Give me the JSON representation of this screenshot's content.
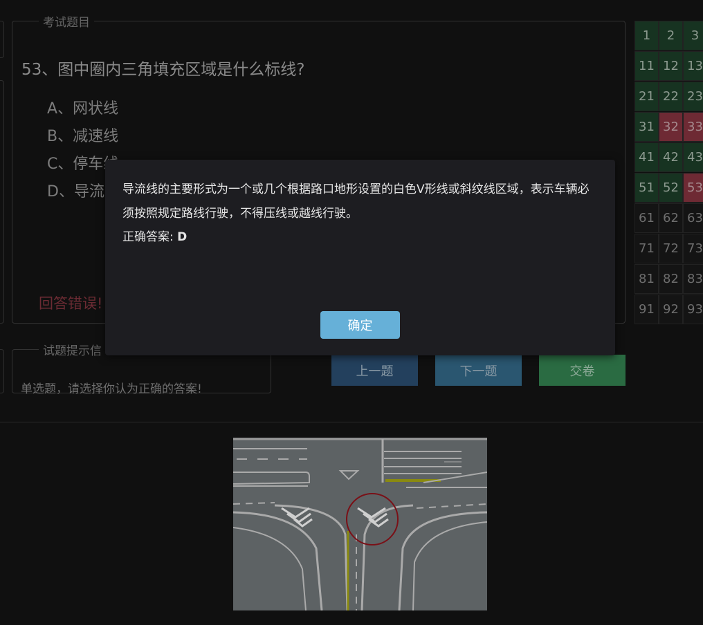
{
  "question_panel": {
    "legend": "考试题目",
    "question": "53、图中圈内三角填充区域是什么标线?",
    "options": [
      "A、网状线",
      "B、减速线",
      "C、停车线",
      "D、导流"
    ],
    "result": "回答错误!"
  },
  "hint_panel": {
    "legend": "试题提示信",
    "text": "单选题，请选择你认为正确的答案!"
  },
  "nav": {
    "prev": "上一题",
    "next": "下一题",
    "submit": "交卷"
  },
  "grid": {
    "rows": [
      [
        {
          "n": "1",
          "s": "done"
        },
        {
          "n": "2",
          "s": "done"
        },
        {
          "n": "3",
          "s": "done"
        }
      ],
      [
        {
          "n": "11",
          "s": "done"
        },
        {
          "n": "12",
          "s": "done"
        },
        {
          "n": "13",
          "s": "done"
        }
      ],
      [
        {
          "n": "21",
          "s": "done"
        },
        {
          "n": "22",
          "s": "done"
        },
        {
          "n": "23",
          "s": "done"
        }
      ],
      [
        {
          "n": "31",
          "s": "done"
        },
        {
          "n": "32",
          "s": "wrong"
        },
        {
          "n": "33",
          "s": "wrong"
        }
      ],
      [
        {
          "n": "41",
          "s": "done"
        },
        {
          "n": "42",
          "s": "done"
        },
        {
          "n": "43",
          "s": "done"
        }
      ],
      [
        {
          "n": "51",
          "s": "done"
        },
        {
          "n": "52",
          "s": "done"
        },
        {
          "n": "53",
          "s": "wrong"
        }
      ],
      [
        {
          "n": "61",
          "s": "todo"
        },
        {
          "n": "62",
          "s": "todo"
        },
        {
          "n": "63",
          "s": "todo"
        }
      ],
      [
        {
          "n": "71",
          "s": "todo"
        },
        {
          "n": "72",
          "s": "todo"
        },
        {
          "n": "73",
          "s": "todo"
        }
      ],
      [
        {
          "n": "81",
          "s": "todo"
        },
        {
          "n": "82",
          "s": "todo"
        },
        {
          "n": "83",
          "s": "todo"
        }
      ],
      [
        {
          "n": "91",
          "s": "todo"
        },
        {
          "n": "92",
          "s": "todo"
        },
        {
          "n": "93",
          "s": "todo"
        }
      ]
    ]
  },
  "dialog": {
    "explanation": "导流线的主要形式为一个或几个根据路口地形设置的白色V形线或斜纹线区域，表示车辆必须按照规定路线行驶，不得压线或越线行驶。",
    "answer_label": "正确答案:",
    "answer_value": "D",
    "confirm": "确定"
  },
  "colors": {
    "confirm_button": "#66b0d8",
    "wrong_cell": "#6e2a34",
    "done_cell": "#173321",
    "wrong_text": "#6b2b33"
  }
}
